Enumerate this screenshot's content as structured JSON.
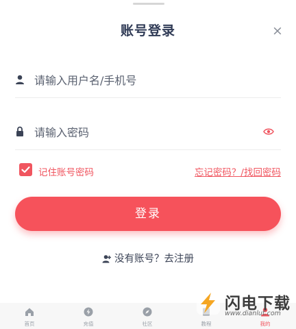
{
  "dialog": {
    "title": "账号登录",
    "close_glyph": "×"
  },
  "form": {
    "username_placeholder": "请输入用户名/手机号",
    "password_placeholder": "请输入密码",
    "remember_label": "记住账号密码",
    "remember_checked": true,
    "forgot_link": "忘记密码？/找回密码",
    "login_button": "登录",
    "register_link": "没有账号？去注册"
  },
  "tabbar": {
    "items": [
      {
        "label": "首页",
        "icon": "home-icon"
      },
      {
        "label": "充值",
        "icon": "lightning-icon"
      },
      {
        "label": "社区",
        "icon": "compass-icon"
      },
      {
        "label": "教程",
        "icon": "book-icon"
      },
      {
        "label": "我的",
        "icon": "person-icon"
      }
    ],
    "active_index": 4
  },
  "watermark": {
    "name": "闪电下载",
    "url": "www.dianlut.com"
  },
  "colors": {
    "accent": "#f6525b",
    "title": "#2f3a55",
    "tab_inactive": "#9aa0a8"
  }
}
